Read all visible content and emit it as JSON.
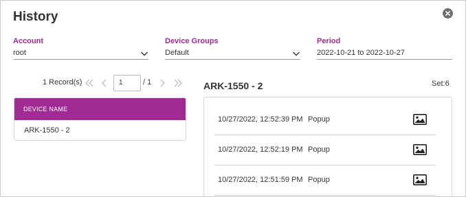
{
  "dialog": {
    "title": "History"
  },
  "filters": {
    "account": {
      "label": "Account",
      "value": "root"
    },
    "device_groups": {
      "label": "Device Groups",
      "value": "Default"
    },
    "period": {
      "label": "Period",
      "value": "2022-10-21 to 2022-10-27"
    }
  },
  "pager": {
    "records": "1 Record(s)",
    "current_page": "1",
    "total": "/ 1"
  },
  "device_table": {
    "header": "DEVICE NAME",
    "rows": [
      "ARK-1550 - 2"
    ]
  },
  "detail": {
    "title": "ARK-1550 - 2",
    "set_count": "Set:6",
    "events": [
      {
        "time": "10/27/2022, 12:52:39 PM",
        "type": "Popup",
        "icon": "image-icon"
      },
      {
        "time": "10/27/2022, 12:52:19 PM",
        "type": "Popup",
        "icon": "image-icon"
      },
      {
        "time": "10/27/2022, 12:51:59 PM",
        "type": "Popup",
        "icon": "image-icon"
      }
    ]
  },
  "colors": {
    "accent": "#a02b93",
    "text": "#333333",
    "border": "#d6d6d6"
  }
}
